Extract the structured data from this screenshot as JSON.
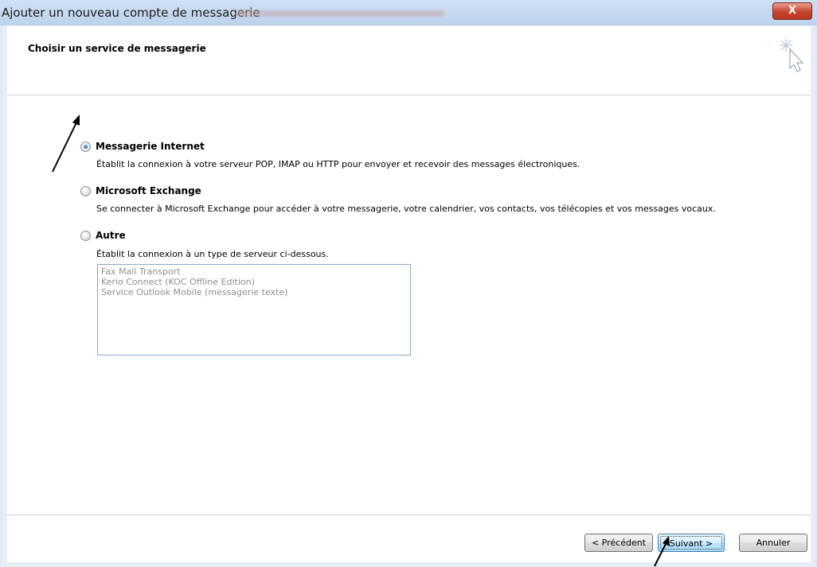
{
  "window": {
    "title": "Ajouter un nouveau compte de messagerie",
    "close_label": "X"
  },
  "header": {
    "page_title": "Choisir un service de messagerie"
  },
  "options": [
    {
      "label": "Messagerie Internet",
      "description": "Établit la connexion à votre serveur POP, IMAP ou HTTP pour envoyer et recevoir des messages électroniques.",
      "selected": true
    },
    {
      "label": "Microsoft Exchange",
      "description": "Se connecter à Microsoft Exchange pour accéder à votre messagerie, votre calendrier, vos contacts, vos télécopies et vos messages vocaux.",
      "selected": false
    },
    {
      "label": "Autre",
      "description": "Établit la connexion à un type de serveur ci-dessous.",
      "selected": false
    }
  ],
  "other_servers": [
    "Fax Mail Transport",
    "Kerio Connect (KOC Offline Edition)",
    "Service Outlook Mobile (messagerie texte)"
  ],
  "footer": {
    "back_label": "< Précédent",
    "next_label": "Suivant >",
    "cancel_label": "Annuler"
  }
}
